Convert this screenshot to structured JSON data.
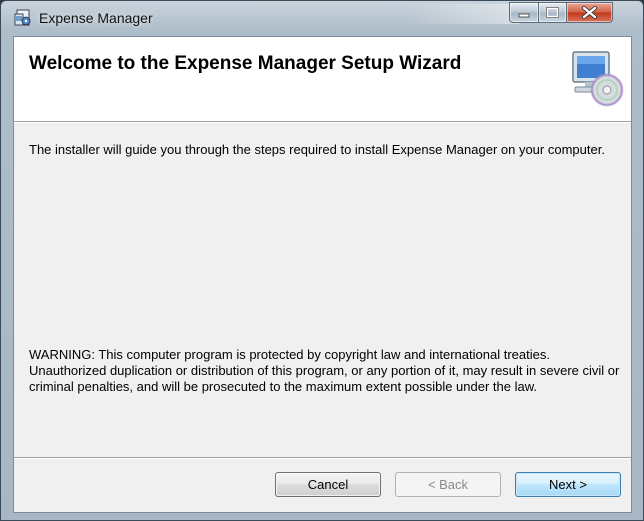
{
  "window": {
    "title": "Expense Manager",
    "controls": {
      "minimize_icon": "minimize-icon",
      "maximize_icon": "maximize-icon",
      "close_icon": "close-icon"
    }
  },
  "banner": {
    "title": "Welcome to the Expense Manager Setup Wizard",
    "graphic_icon": "computer-cd-icon"
  },
  "body": {
    "intro": "The installer will guide you through the steps required to install Expense Manager on your computer.",
    "warning": "WARNING: This computer program is protected by copyright law and international treaties. Unauthorized duplication or distribution of this program, or any portion of it, may result in severe civil or criminal penalties, and will be prosecuted to the maximum extent possible under the law."
  },
  "buttons": {
    "cancel": "Cancel",
    "back": "< Back",
    "next": "Next >"
  },
  "colors": {
    "close_red": "#c0391c",
    "next_accent": "#3c7fb1"
  }
}
